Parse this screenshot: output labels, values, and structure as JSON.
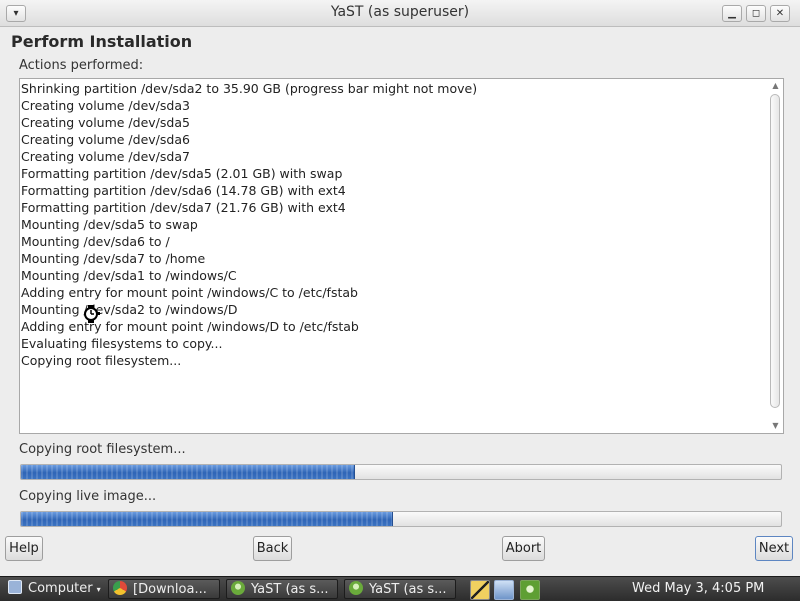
{
  "window": {
    "title": "YaST (as superuser)",
    "menu_icon": "chevron-down-icon",
    "minimize_icon": "minimize-icon",
    "maximize_icon": "maximize-icon",
    "close_icon": "close-icon"
  },
  "page": {
    "heading": "Perform Installation",
    "actions_label": "Actions performed:"
  },
  "log": {
    "lines": [
      "Shrinking partition /dev/sda2 to 35.90 GB (progress bar might not move)",
      "Creating volume /dev/sda3",
      "Creating volume /dev/sda5",
      "Creating volume /dev/sda6",
      "Creating volume /dev/sda7",
      "Formatting partition /dev/sda5 (2.01 GB) with swap",
      "Formatting partition /dev/sda6 (14.78 GB) with ext4",
      "Formatting partition /dev/sda7 (21.76 GB) with ext4",
      "Mounting /dev/sda5 to swap",
      "Mounting /dev/sda6 to /",
      "Mounting /dev/sda7 to /home",
      "Mounting /dev/sda1 to /windows/C",
      "Adding entry for mount point /windows/C to /etc/fstab",
      "Mounting /dev/sda2 to /windows/D",
      "Adding entry for mount point /windows/D to /etc/fstab",
      "Evaluating filesystems to copy...",
      "Copying root filesystem..."
    ]
  },
  "progress": {
    "step_label": "Copying root filesystem...",
    "step_fraction": 0.44,
    "overall_label": "Copying live image...",
    "overall_fraction": 0.49
  },
  "buttons": {
    "help": "Help",
    "back": "Back",
    "abort": "Abort",
    "next": "Next"
  },
  "taskbar": {
    "start_label": "Computer",
    "tasks": [
      {
        "label": "[Downloa...",
        "icon": "chrome-icon"
      },
      {
        "label": "YaST (as s...",
        "icon": "yast-icon"
      },
      {
        "label": "YaST (as s...",
        "icon": "yast-icon"
      }
    ],
    "tray_icons": [
      "system-monitor-icon",
      "network-icon",
      "yast-updater-icon"
    ],
    "clock": "Wed May  3,  4:05 PM"
  },
  "colors": {
    "progress_fill": "#3a6fc0",
    "next_border": "#5d86c2"
  }
}
